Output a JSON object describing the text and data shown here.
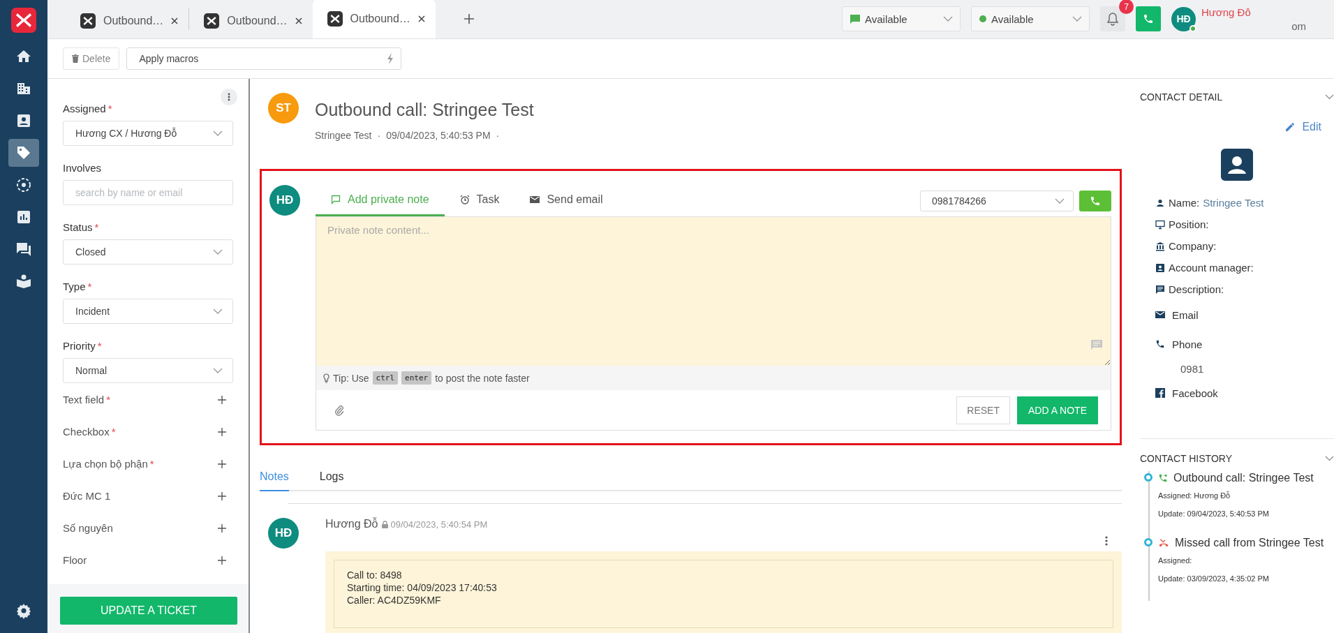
{
  "nav": {
    "items": [
      {
        "kind": "home",
        "selected": false
      },
      {
        "kind": "building",
        "selected": false
      },
      {
        "kind": "contact",
        "selected": false
      },
      {
        "kind": "tag",
        "selected": true
      },
      {
        "kind": "target",
        "selected": false
      },
      {
        "kind": "chart",
        "selected": false
      },
      {
        "kind": "chat",
        "selected": false
      },
      {
        "kind": "book",
        "selected": false
      }
    ],
    "bottom": {
      "kind": "settings"
    }
  },
  "tabs": [
    {
      "label": "Outbound…",
      "selected": false
    },
    {
      "label": "Outbound…",
      "selected": false
    },
    {
      "label": "Outbound…",
      "selected": true
    }
  ],
  "header": {
    "chat_status": "Available",
    "call_status": "Available",
    "notifications": "7",
    "user_initials": "HĐ",
    "user_online": true,
    "user_name": "Hương Đô",
    "user_email": "om"
  },
  "toolbar": {
    "delete": "Delete",
    "macros": "Apply macros"
  },
  "ticket_form": {
    "fields": [
      {
        "label": "Assigned",
        "required_mark": "*",
        "kind": "select",
        "value": "Hương CX / Hương Đỗ"
      },
      {
        "label": "Involves",
        "kind": "input",
        "placeholder": "search by name or email"
      },
      {
        "label": "Status",
        "required_mark": "*",
        "kind": "select",
        "value": "Closed"
      },
      {
        "label": "Type",
        "required_mark": "*",
        "kind": "select",
        "value": "Incident"
      },
      {
        "label": "Priority",
        "required_mark": "*",
        "kind": "select",
        "value": "Normal"
      }
    ],
    "custom_fields": [
      {
        "label": "Text field",
        "required_mark": "*"
      },
      {
        "label": "Checkbox",
        "required_mark": "*"
      },
      {
        "label": "Lựa chọn bộ phận",
        "required_mark": "*"
      },
      {
        "label": "Đức MC 1"
      },
      {
        "label": "Số nguyên"
      },
      {
        "label": "Floor"
      }
    ],
    "update_button": "UPDATE A TICKET"
  },
  "ticket": {
    "avatar": "ST",
    "title": "Outbound call: Stringee Test",
    "requester": "Stringee Test",
    "separators": [
      "·",
      "·"
    ],
    "time": "09/04/2023, 5:40:53 PM"
  },
  "composer": {
    "avatar": "HĐ",
    "tabs": [
      {
        "label": "Add private note",
        "selected": true
      },
      {
        "label": "Task",
        "selected": false
      },
      {
        "label": "Send email",
        "selected": false
      }
    ],
    "phone": "0981784266",
    "placeholder": "Private note content...",
    "tip_prefix": "Tip: Use",
    "tip_keys": [
      "ctrl",
      "enter"
    ],
    "tip_suffix": "to post the note faster",
    "reset": "RESET",
    "add": "ADD A NOTE"
  },
  "notes_tabs": [
    {
      "label": "Notes",
      "selected": true
    },
    {
      "label": "Logs",
      "selected": false
    }
  ],
  "note": {
    "avatar": "HĐ",
    "author": "Hương Đỗ",
    "time": "09/04/2023, 5:40:54 PM",
    "lines": [
      "Call to: 8498",
      "Starting time: 04/09/2023 17:40:53",
      "Caller: AC4DZ59KMF"
    ]
  },
  "contact_detail": {
    "title": "CONTACT DETAIL",
    "edit": "Edit",
    "name_label": "Name:",
    "name_value": "Stringee Test",
    "fields": [
      {
        "label": "Position:"
      },
      {
        "label": "Company:"
      },
      {
        "label": "Account manager:"
      },
      {
        "label": "Description:"
      }
    ],
    "email_label": "Email",
    "phone_label": "Phone",
    "phone_value": "0981",
    "facebook_label": "Facebook"
  },
  "contact_history": {
    "title": "CONTACT HISTORY",
    "items": [
      {
        "kind": "outbound",
        "title": "Outbound call: Stringee Test",
        "assigned": "Assigned: Hương Đỗ",
        "update": "Update: 09/04/2023, 5:40:53 PM"
      },
      {
        "kind": "missed",
        "title": "Missed call from Stringee Test",
        "assigned": "Assigned:",
        "update": "Update: 03/09/2023, 4:35:02 PM"
      }
    ]
  }
}
